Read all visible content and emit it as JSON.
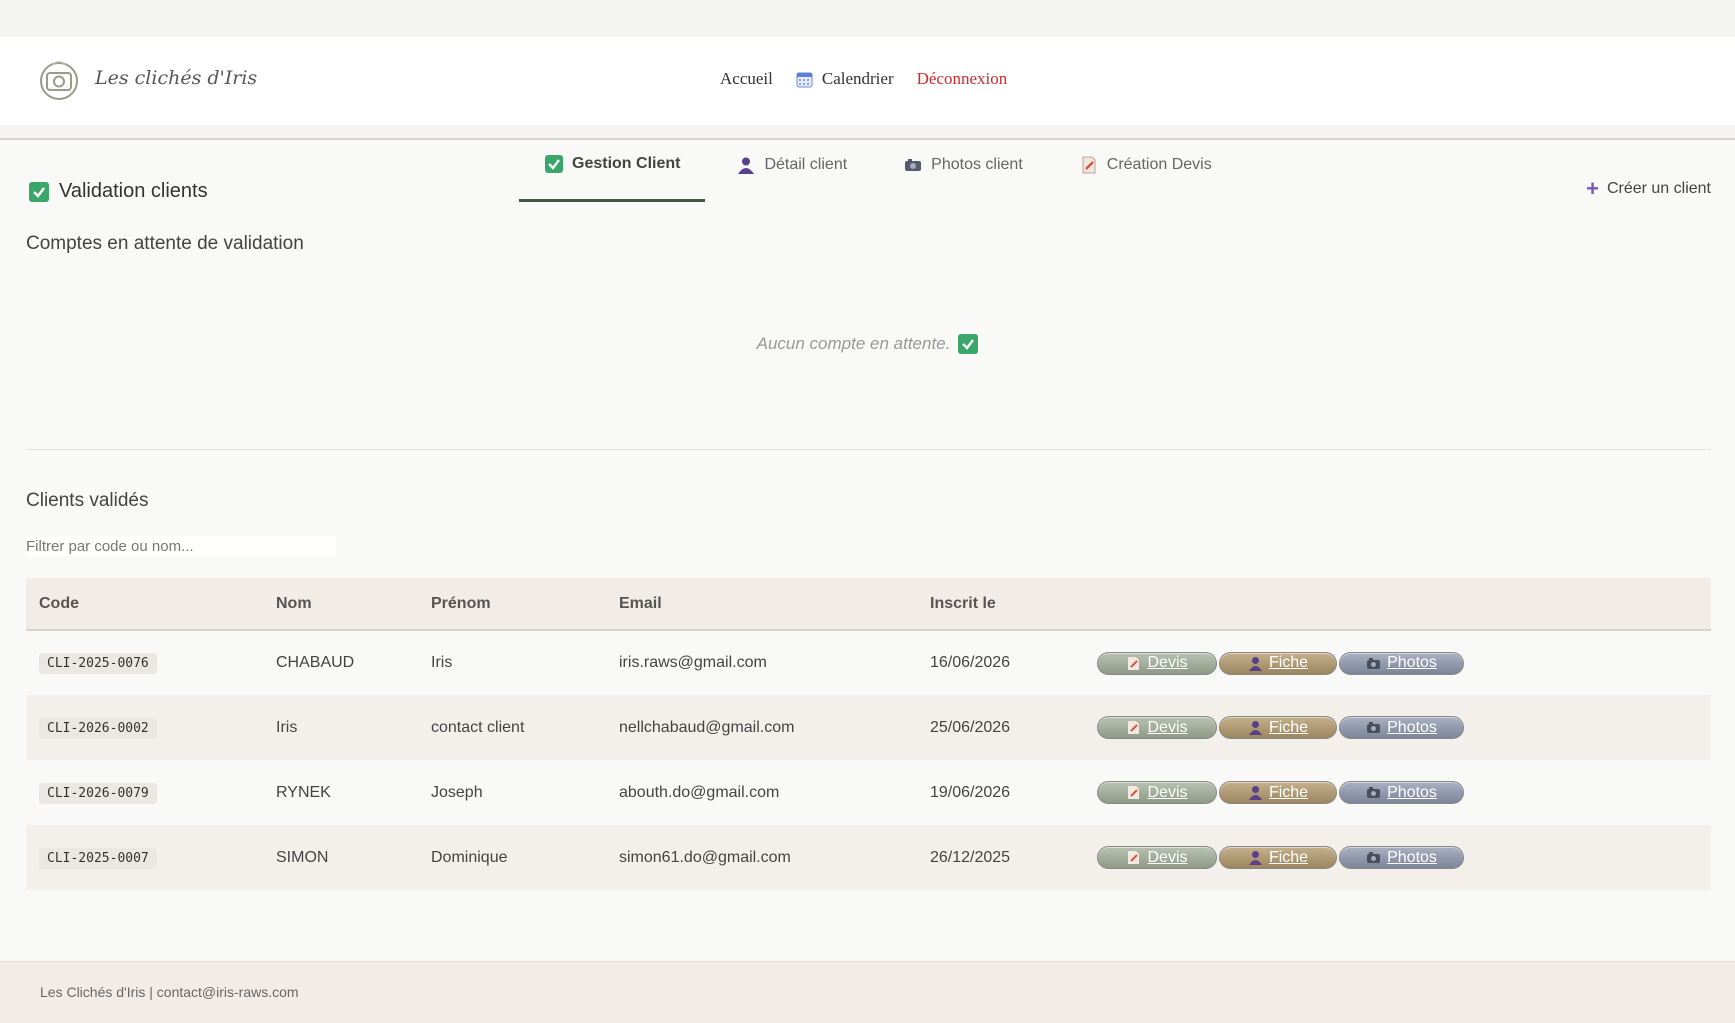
{
  "header": {
    "brand": "Les clichés d'Iris",
    "nav": {
      "home": "Accueil",
      "calendar": "Calendrier",
      "logout": "Déconnexion"
    }
  },
  "page": {
    "title": "Validation clients",
    "create_button": "Créer un client"
  },
  "tabs": [
    {
      "label": "Gestion Client",
      "icon": "check-icon",
      "active": true
    },
    {
      "label": "Détail client",
      "icon": "user-icon",
      "active": false
    },
    {
      "label": "Photos client",
      "icon": "camera-icon",
      "active": false
    },
    {
      "label": "Création Devis",
      "icon": "document-icon",
      "active": false
    }
  ],
  "pending": {
    "title": "Comptes en attente de validation",
    "empty_message": "Aucun compte en attente."
  },
  "validated": {
    "title": "Clients validés",
    "filter_placeholder": "Filtrer par code ou nom...",
    "columns": [
      "Code",
      "Nom",
      "Prénom",
      "Email",
      "Inscrit le"
    ],
    "actions": {
      "devis": "Devis",
      "fiche": "Fiche",
      "photos": "Photos"
    },
    "rows": [
      {
        "code": "CLI-2025-0076",
        "nom": "CHABAUD",
        "prenom": "Iris",
        "email": "iris.raws@gmail.com",
        "date": "16/06/2026"
      },
      {
        "code": "CLI-2026-0002",
        "nom": "Iris",
        "prenom": "contact client",
        "email": "nellchabaud@gmail.com",
        "date": "25/06/2026"
      },
      {
        "code": "CLI-2026-0079",
        "nom": "RYNEK",
        "prenom": "Joseph",
        "email": "abouth.do@gmail.com",
        "date": "19/06/2026"
      },
      {
        "code": "CLI-2025-0007",
        "nom": "SIMON",
        "prenom": "Dominique",
        "email": "simon61.do@gmail.com",
        "date": "26/12/2025"
      }
    ]
  },
  "footer": {
    "text": "Les Clichés d'Iris  |  contact@iris-raws.com"
  },
  "colors": {
    "logout": "#d32b2b",
    "accent_green": "#3e5a44",
    "plus_purple": "#7a56b8",
    "check_green": "#3aa66a"
  }
}
